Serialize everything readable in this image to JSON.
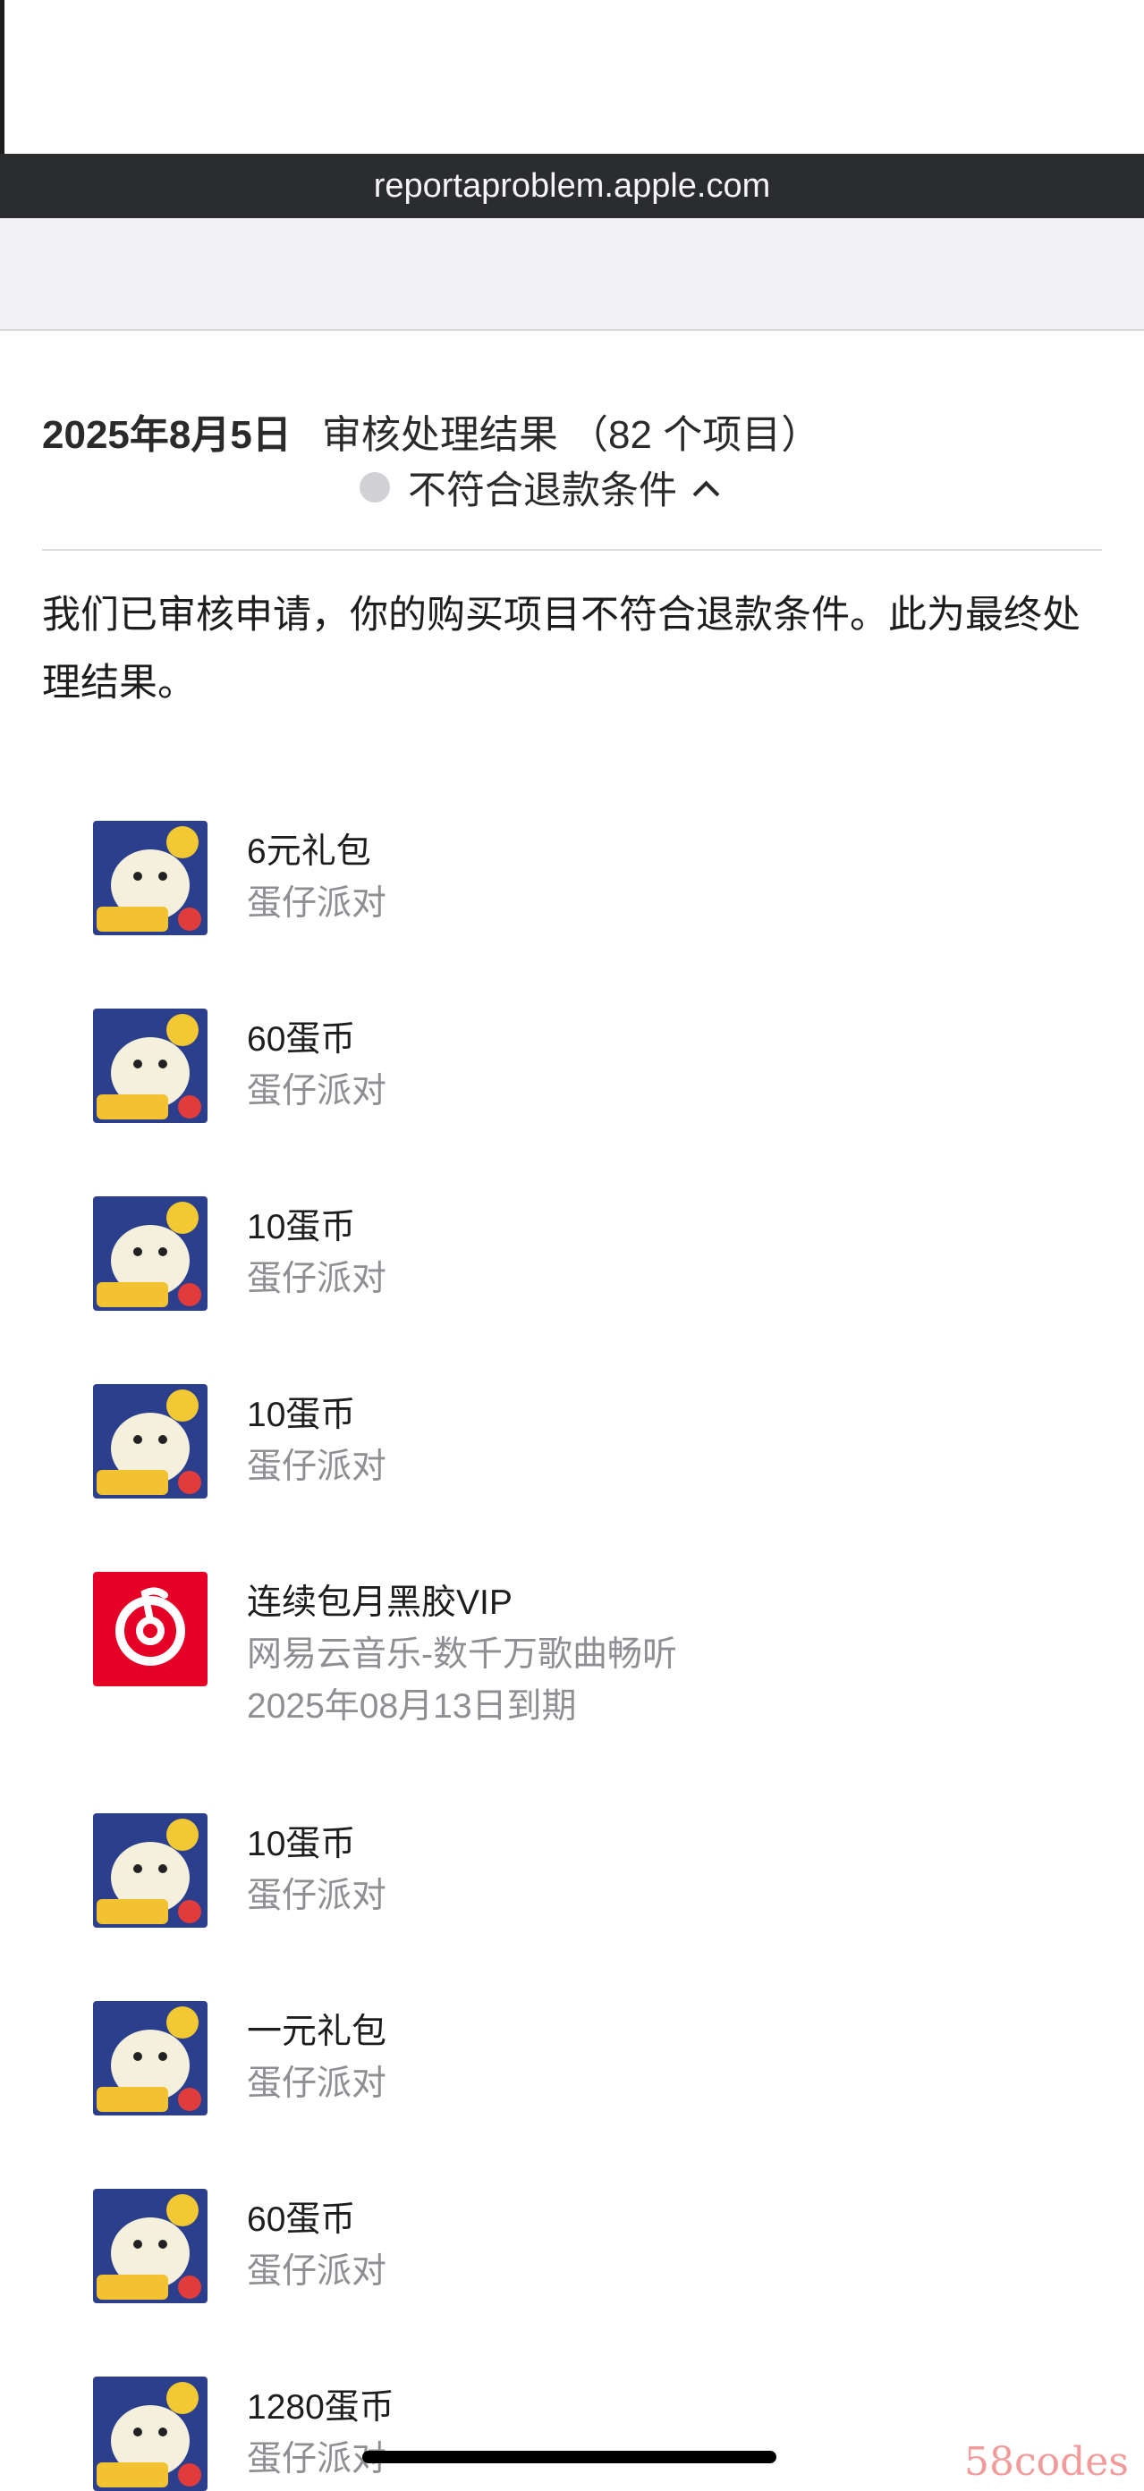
{
  "browser": {
    "url": "reportaproblem.apple.com"
  },
  "report": {
    "date": "2025年8月5日",
    "title": "审核处理结果 （82 个项目）",
    "status": "不符合退款条件",
    "message": "我们已审核申请，你的购买项目不符合退款条件。此为最终处理结果。"
  },
  "items": [
    {
      "name": "6元礼包",
      "app": "蛋仔派对",
      "icon": "eggy-party-app-icon"
    },
    {
      "name": "60蛋币",
      "app": "蛋仔派对",
      "icon": "eggy-party-app-icon"
    },
    {
      "name": "10蛋币",
      "app": "蛋仔派对",
      "icon": "eggy-party-app-icon"
    },
    {
      "name": "10蛋币",
      "app": "蛋仔派对",
      "icon": "eggy-party-app-icon"
    },
    {
      "name": "连续包月黑胶VIP",
      "app": "网易云音乐-数千万歌曲畅听",
      "expiry": "2025年08月13日到期",
      "icon": "netease-music-app-icon"
    },
    {
      "name": "10蛋币",
      "app": "蛋仔派对",
      "icon": "eggy-party-app-icon"
    },
    {
      "name": "一元礼包",
      "app": "蛋仔派对",
      "icon": "eggy-party-app-icon"
    },
    {
      "name": "60蛋币",
      "app": "蛋仔派对",
      "icon": "eggy-party-app-icon"
    },
    {
      "name": "1280蛋币",
      "app": "蛋仔派对",
      "icon": "eggy-party-app-icon"
    }
  ],
  "watermark": "58codes",
  "colors": {
    "status_dot": "#d1d1d6",
    "netease_red": "#e60026",
    "secondary_text": "#8e8e93"
  }
}
